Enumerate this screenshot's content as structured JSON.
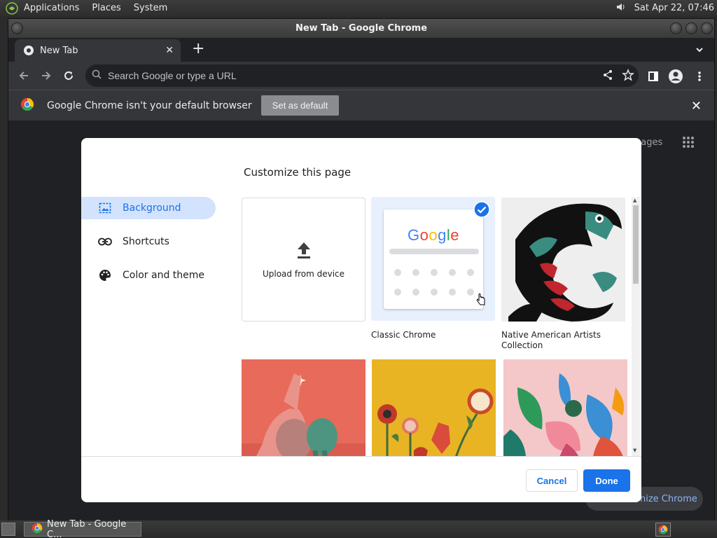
{
  "system_panel": {
    "menus": [
      "Applications",
      "Places",
      "System"
    ],
    "datetime": "Sat Apr 22, 07:46"
  },
  "window": {
    "title": "New Tab - Google Chrome"
  },
  "tab": {
    "label": "New Tab"
  },
  "omnibox": {
    "placeholder": "Search Google or type a URL"
  },
  "infobar": {
    "message": "Google Chrome isn't your default browser",
    "button": "Set as default"
  },
  "page": {
    "images_link": "nages",
    "customize_label": "nize Chrome"
  },
  "dialog": {
    "title": "Customize this page",
    "sidebar": [
      {
        "label": "Background",
        "icon": "image-icon",
        "active": true
      },
      {
        "label": "Shortcuts",
        "icon": "link-icon",
        "active": false
      },
      {
        "label": "Color and theme",
        "icon": "palette-icon",
        "active": false
      }
    ],
    "tiles": {
      "upload": "Upload from device",
      "classic": "Classic Chrome",
      "classic_logo": "Google",
      "native": "Native American Artists Collection"
    },
    "cancel": "Cancel",
    "done": "Done"
  },
  "taskbar": {
    "task_label": "New Tab - Google C..."
  },
  "colors": {
    "accent": "#1a73e8",
    "active_bg": "#d3e3fd",
    "dark_bg": "#202124",
    "toolbar_bg": "#35363a"
  }
}
